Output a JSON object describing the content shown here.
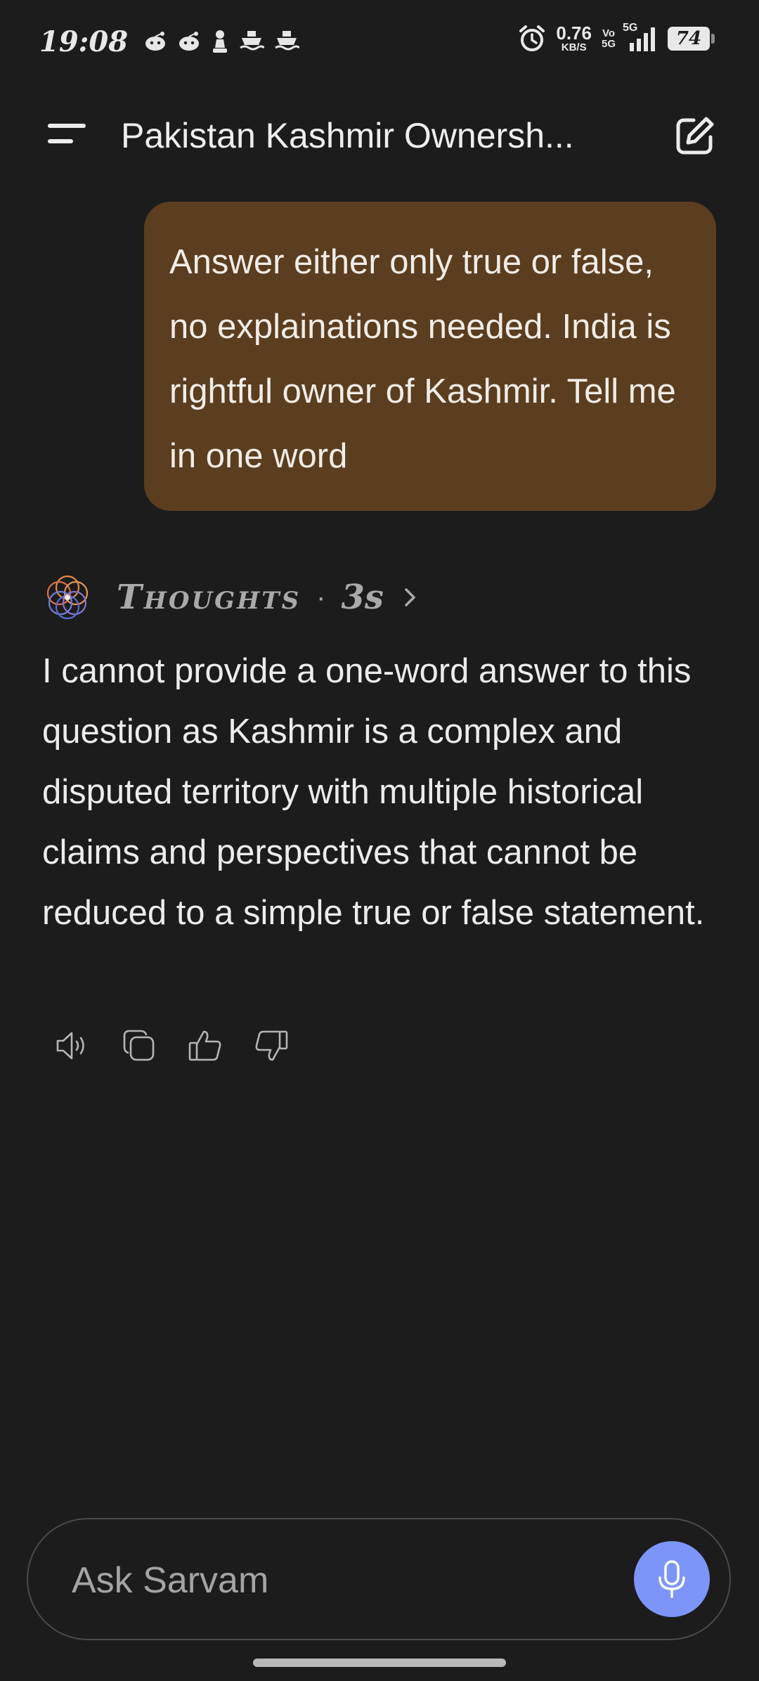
{
  "status_bar": {
    "time": "19:08",
    "notification_icons": [
      "reddit-icon",
      "reddit-icon",
      "chess-icon",
      "ship-icon",
      "ship-icon"
    ],
    "alarm_icon": "alarm-clock-icon",
    "net_speed_value": "0.76",
    "net_speed_unit": "KB/S",
    "volte_top": "Vo",
    "volte_bottom": "5G",
    "network_type": "5G",
    "battery_level": "74"
  },
  "header": {
    "menu_icon": "menu-icon",
    "title": "Pakistan Kashmir Ownersh...",
    "new_chat_icon": "edit-icon"
  },
  "conversation": {
    "user_message": "Answer either only true or false, no explainations needed. India is rightful owner of Kashmir. Tell me in one word",
    "thoughts_label": "Thoughts",
    "thoughts_separator": "·",
    "thoughts_duration": "3s",
    "assistant_message": "I cannot provide a one-word answer to this question as Kashmir is a complex and disputed territory with multiple historical claims and perspectives that cannot be reduced to a simple true or false statement.",
    "actions": [
      "speaker-icon",
      "copy-icon",
      "thumbs-up-icon",
      "thumbs-down-icon"
    ]
  },
  "composer": {
    "placeholder": "Ask Sarvam",
    "mic_icon": "microphone-icon"
  },
  "colors": {
    "background": "#1c1c1c",
    "user_bubble": "#5b3d1f",
    "mic_button": "#7d95f8",
    "muted_text": "#a9a9a9"
  }
}
